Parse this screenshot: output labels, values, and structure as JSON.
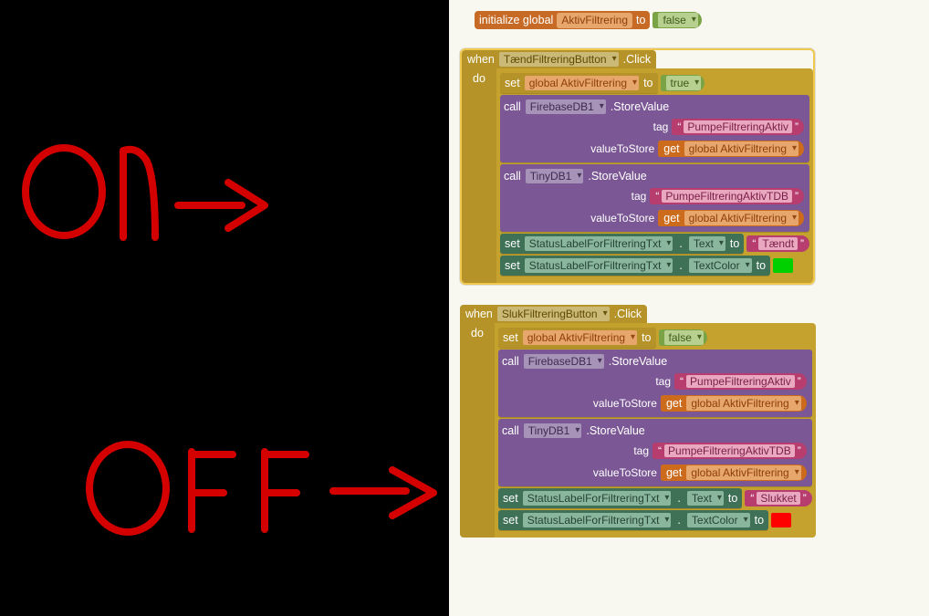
{
  "left_annotations": {
    "on": "on",
    "off": "OFF"
  },
  "init": {
    "kw_initialize": "initialize global",
    "var_name": "AktivFiltrering",
    "kw_to": "to",
    "value": "false"
  },
  "events": [
    {
      "kw_when": "when",
      "component": "TændFiltreringButton",
      "event": ".Click",
      "kw_do": "do",
      "highlight": true,
      "rows": [
        {
          "type": "set-var",
          "kw_set": "set",
          "var": "global AktivFiltrering",
          "kw_to": "to",
          "bool": "true"
        },
        {
          "type": "call",
          "kw_call": "call",
          "comp": "FirebaseDB1",
          "method": ".StoreValue",
          "args": [
            {
              "label": "tag",
              "val": {
                "type": "string",
                "text": "PumpeFiltreringAktiv"
              }
            },
            {
              "label": "valueToStore",
              "val": {
                "type": "get",
                "kw_get": "get",
                "var": "global AktivFiltrering"
              }
            }
          ]
        },
        {
          "type": "call",
          "kw_call": "call",
          "comp": "TinyDB1",
          "method": ".StoreValue",
          "args": [
            {
              "label": "tag",
              "val": {
                "type": "string",
                "text": "PumpeFiltreringAktivTDB"
              }
            },
            {
              "label": "valueToStore",
              "val": {
                "type": "get",
                "kw_get": "get",
                "var": "global AktivFiltrering"
              }
            }
          ]
        },
        {
          "type": "set-prop",
          "kw_set": "set",
          "comp": "StatusLabelForFiltreringTxt",
          "prop": "Text",
          "kw_to": "to",
          "val": {
            "type": "string",
            "text": "Tændt"
          }
        },
        {
          "type": "set-prop",
          "kw_set": "set",
          "comp": "StatusLabelForFiltreringTxt",
          "prop": "TextColor",
          "kw_to": "to",
          "val": {
            "type": "swatch",
            "color": "green"
          }
        }
      ]
    },
    {
      "kw_when": "when",
      "component": "SlukFiltreringButton",
      "event": ".Click",
      "kw_do": "do",
      "highlight": false,
      "rows": [
        {
          "type": "set-var",
          "kw_set": "set",
          "var": "global AktivFiltrering",
          "kw_to": "to",
          "bool": "false"
        },
        {
          "type": "call",
          "kw_call": "call",
          "comp": "FirebaseDB1",
          "method": ".StoreValue",
          "args": [
            {
              "label": "tag",
              "val": {
                "type": "string",
                "text": "PumpeFiltreringAktiv"
              }
            },
            {
              "label": "valueToStore",
              "val": {
                "type": "get",
                "kw_get": "get",
                "var": "global AktivFiltrering"
              }
            }
          ]
        },
        {
          "type": "call",
          "kw_call": "call",
          "comp": "TinyDB1",
          "method": ".StoreValue",
          "args": [
            {
              "label": "tag",
              "val": {
                "type": "string",
                "text": "PumpeFiltreringAktivTDB"
              }
            },
            {
              "label": "valueToStore",
              "val": {
                "type": "get",
                "kw_get": "get",
                "var": "global AktivFiltrering"
              }
            }
          ]
        },
        {
          "type": "set-prop",
          "kw_set": "set",
          "comp": "StatusLabelForFiltreringTxt",
          "prop": "Text",
          "kw_to": "to",
          "val": {
            "type": "string",
            "text": "Slukket"
          }
        },
        {
          "type": "set-prop",
          "kw_set": "set",
          "comp": "StatusLabelForFiltreringTxt",
          "prop": "TextColor",
          "kw_to": "to",
          "val": {
            "type": "swatch",
            "color": "red"
          }
        }
      ]
    }
  ]
}
